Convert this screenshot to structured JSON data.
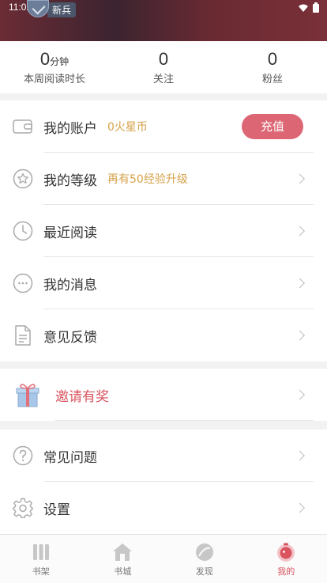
{
  "status_bar": {
    "time": "11:02"
  },
  "header": {
    "rank_badge": "新兵"
  },
  "stats": [
    {
      "value": "0",
      "unit": "分钟",
      "label": "本周阅读时长"
    },
    {
      "value": "0",
      "unit": "",
      "label": "关注"
    },
    {
      "value": "0",
      "unit": "",
      "label": "粉丝"
    }
  ],
  "menu": {
    "account": {
      "label": "我的账户",
      "balance": "0火星币",
      "button": "充值"
    },
    "level": {
      "label": "我的等级",
      "hint": "再有50经验升级"
    },
    "recent": {
      "label": "最近阅读"
    },
    "messages": {
      "label": "我的消息"
    },
    "feedback": {
      "label": "意见反馈"
    },
    "invite": {
      "label": "邀请有奖"
    },
    "faq": {
      "label": "常见问题"
    },
    "settings": {
      "label": "设置"
    }
  },
  "tabbar": [
    {
      "label": "书架",
      "icon": "bookshelf-icon"
    },
    {
      "label": "书城",
      "icon": "bookstore-icon"
    },
    {
      "label": "发现",
      "icon": "discover-icon"
    },
    {
      "label": "我的",
      "icon": "profile-icon",
      "active": true
    }
  ],
  "colors": {
    "accent": "#dd6674",
    "gold": "#d4a24a",
    "invite_text": "#d9545f"
  }
}
